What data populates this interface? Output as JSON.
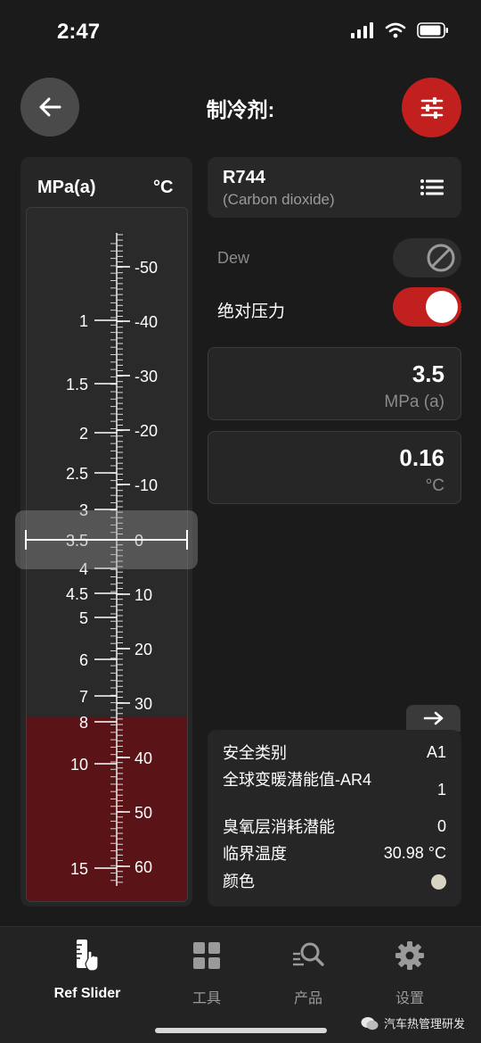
{
  "status_bar": {
    "time": "2:47"
  },
  "header": {
    "title": "制冷剂:"
  },
  "slider": {
    "unit_left": "MPa(a)",
    "unit_right": "°C",
    "pressure_labels": [
      "1",
      "1.5",
      "2",
      "2.5",
      "3",
      "3.5",
      "4",
      "4.5",
      "5",
      "6",
      "7",
      "8",
      "10",
      "15"
    ],
    "temperature_labels": [
      "-50",
      "-40",
      "-30",
      "-20",
      "-10",
      "0",
      "10",
      "20",
      "30",
      "40",
      "50",
      "60"
    ]
  },
  "refrigerant": {
    "code": "R744",
    "name": "(Carbon dioxide)"
  },
  "dew": {
    "label": "Dew",
    "enabled": false
  },
  "absolute_pressure": {
    "label": "绝对压力",
    "enabled": true
  },
  "pressure_value": {
    "value": "3.5",
    "unit": "MPa (a)"
  },
  "temperature_value": {
    "value": "0.16",
    "unit": "°C"
  },
  "info": {
    "safety_class_label": "安全类别",
    "safety_class_value": "A1",
    "gwp_label": "全球变暖潜能值-AR4",
    "gwp_value": "1",
    "odp_label": "臭氧层消耗潜能",
    "odp_value": "0",
    "critical_temp_label": "临界温度",
    "critical_temp_value": "30.98 °C",
    "color_label": "颜色",
    "color_value": "#d8d3c3"
  },
  "tabs": [
    {
      "label": "Ref Slider",
      "icon": "ruler-hand-icon",
      "active": true
    },
    {
      "label": "工具",
      "icon": "grid-icon",
      "active": false
    },
    {
      "label": "产品",
      "icon": "search-list-icon",
      "active": false
    },
    {
      "label": "设置",
      "icon": "gear-icon",
      "active": false
    }
  ],
  "watermark": "汽车热管理研发",
  "colors": {
    "accent": "#c21f1f",
    "danger_zone": "#5a1418",
    "background": "#1b1b1b"
  }
}
